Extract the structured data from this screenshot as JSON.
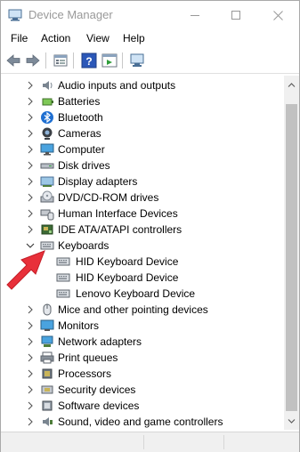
{
  "window": {
    "title": "Device Manager"
  },
  "menu": {
    "file": "File",
    "action": "Action",
    "view": "View",
    "help": "Help"
  },
  "tree": {
    "categories": [
      {
        "label": "Audio inputs and outputs",
        "icon": "speaker-icon",
        "expanded": false
      },
      {
        "label": "Batteries",
        "icon": "battery-icon",
        "expanded": false
      },
      {
        "label": "Bluetooth",
        "icon": "bluetooth-icon",
        "expanded": false
      },
      {
        "label": "Cameras",
        "icon": "camera-icon",
        "expanded": false
      },
      {
        "label": "Computer",
        "icon": "computer-icon",
        "expanded": false
      },
      {
        "label": "Disk drives",
        "icon": "disk-drive-icon",
        "expanded": false
      },
      {
        "label": "Display adapters",
        "icon": "display-adapter-icon",
        "expanded": false
      },
      {
        "label": "DVD/CD-ROM drives",
        "icon": "dvd-drive-icon",
        "expanded": false
      },
      {
        "label": "Human Interface Devices",
        "icon": "hid-icon",
        "expanded": false
      },
      {
        "label": "IDE ATA/ATAPI controllers",
        "icon": "ide-controller-icon",
        "expanded": false
      },
      {
        "label": "Keyboards",
        "icon": "keyboard-icon",
        "expanded": true
      },
      {
        "label": "Mice and other pointing devices",
        "icon": "mouse-icon",
        "expanded": false
      },
      {
        "label": "Monitors",
        "icon": "monitor-icon",
        "expanded": false
      },
      {
        "label": "Network adapters",
        "icon": "network-adapter-icon",
        "expanded": false
      },
      {
        "label": "Print queues",
        "icon": "printer-icon",
        "expanded": false
      },
      {
        "label": "Processors",
        "icon": "processor-icon",
        "expanded": false
      },
      {
        "label": "Security devices",
        "icon": "security-device-icon",
        "expanded": false
      },
      {
        "label": "Software devices",
        "icon": "software-device-icon",
        "expanded": false
      },
      {
        "label": "Sound, video and game controllers",
        "icon": "sound-controller-icon",
        "expanded": false
      }
    ],
    "keyboard_devices": [
      {
        "label": "HID Keyboard Device",
        "icon": "keyboard-icon"
      },
      {
        "label": "HID Keyboard Device",
        "icon": "keyboard-icon"
      },
      {
        "label": "Lenovo Keyboard Device",
        "icon": "keyboard-icon"
      }
    ]
  },
  "colors": {
    "annotation_arrow": "#e8303a",
    "title_text": "#999999",
    "scroll_thumb": "#c1c1c1"
  }
}
